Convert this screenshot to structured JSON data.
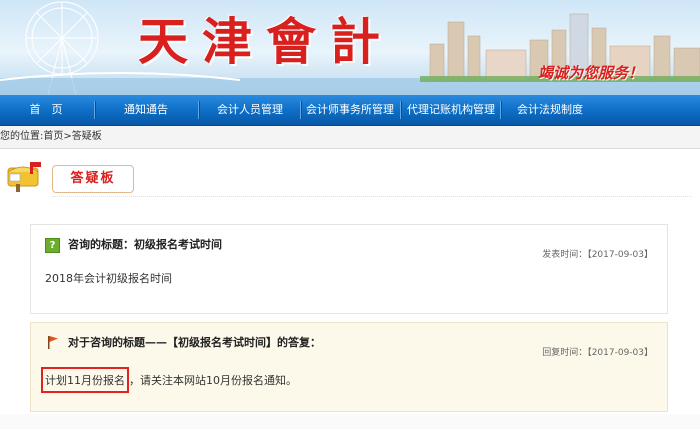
{
  "banner": {
    "title": "天津會計",
    "slogan": "竭诚为您服务！"
  },
  "nav": {
    "items": [
      {
        "label": "首　页"
      },
      {
        "label": "通知通告"
      },
      {
        "label": "会计人员管理"
      },
      {
        "label": "会计师事务所管理"
      },
      {
        "label": "代理记账机构管理"
      },
      {
        "label": "会计法规制度"
      }
    ]
  },
  "breadcrumb": {
    "text": "您的位置:首页>答疑板"
  },
  "section": {
    "title": "答疑板"
  },
  "question": {
    "title": "咨询的标题：初级报名考试时间",
    "time": "发表时间：【2017-09-03】",
    "body": "2018年会计初级报名时间"
  },
  "answer": {
    "title": "对于咨询的标题——【初级报名考试时间】的答复：",
    "time": "回复时间：【2017-09-03】",
    "highlight": "计划11月份报名",
    "body_rest": "，请关注本网站10月份报名通知。"
  },
  "colors": {
    "nav_blue": "#0e6fc6",
    "title_red": "#d8201f",
    "highlight_border": "#e0231e",
    "answer_bg": "#fdf9ea"
  },
  "icons": {
    "question": "question-mark-icon",
    "answer": "flag-icon",
    "section": "mailbox-icon"
  }
}
